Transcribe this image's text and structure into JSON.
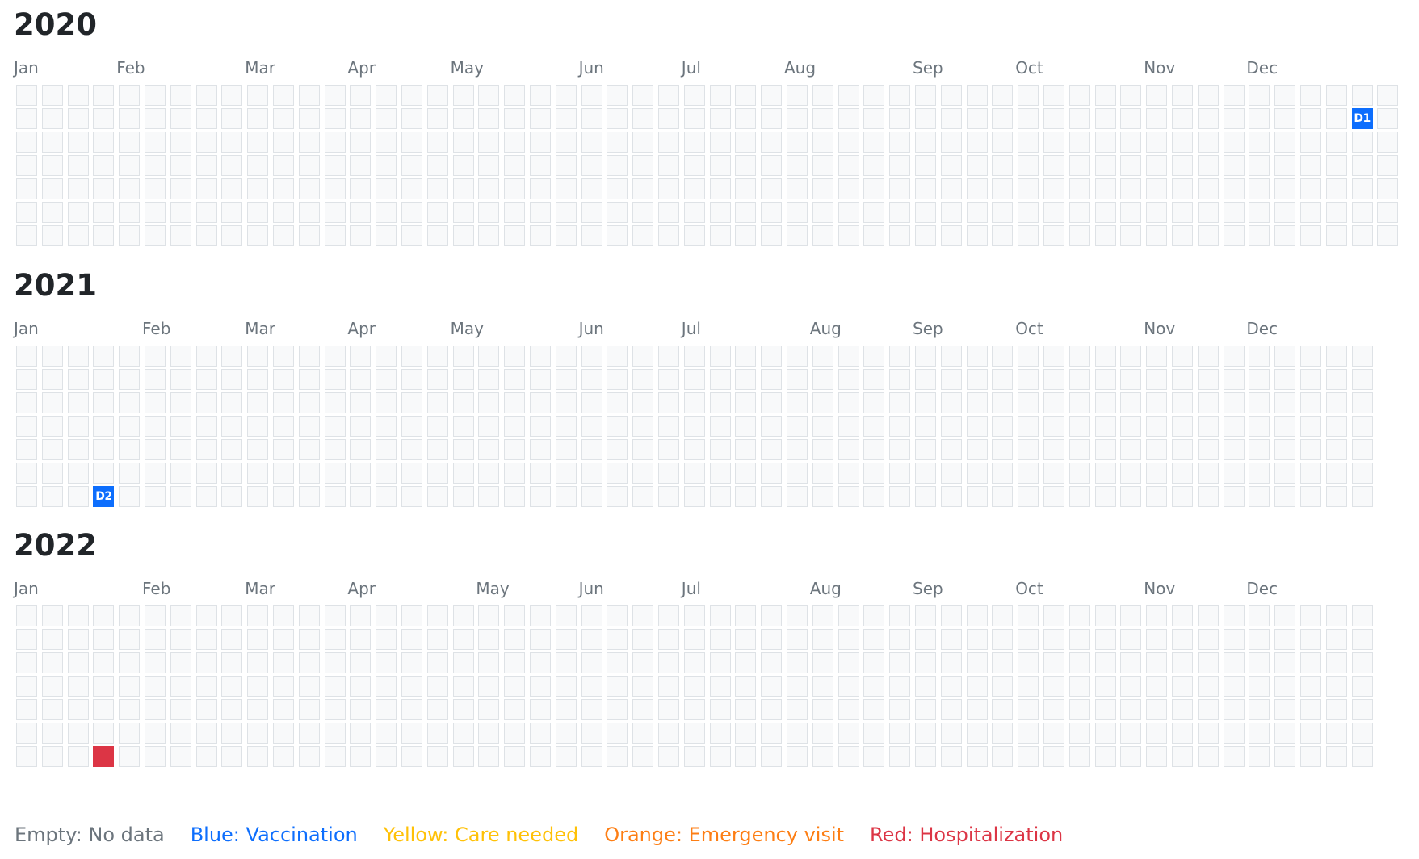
{
  "years": [
    {
      "label": "2020",
      "weeks": 54,
      "jan1_weekday": 3,
      "months": [
        "Jan",
        "Feb",
        "Mar",
        "Apr",
        "May",
        "Jun",
        "Jul",
        "Aug",
        "Sep",
        "Oct",
        "Nov",
        "Dec"
      ],
      "events": [
        {
          "week": 52,
          "day": 1,
          "type": "blue",
          "label": "D1"
        }
      ]
    },
    {
      "label": "2021",
      "weeks": 53,
      "jan1_weekday": 5,
      "months": [
        "Jan",
        "Feb",
        "Mar",
        "Apr",
        "May",
        "Jun",
        "Jul",
        "Aug",
        "Sep",
        "Oct",
        "Nov",
        "Dec"
      ],
      "events": [
        {
          "week": 3,
          "day": 6,
          "type": "blue",
          "label": "D2"
        }
      ]
    },
    {
      "label": "2022",
      "weeks": 53,
      "jan1_weekday": 6,
      "months": [
        "Jan",
        "Feb",
        "Mar",
        "Apr",
        "May",
        "Jun",
        "Jul",
        "Aug",
        "Sep",
        "Oct",
        "Nov",
        "Dec"
      ],
      "events": [
        {
          "week": 3,
          "day": 6,
          "type": "red",
          "label": ""
        }
      ]
    }
  ],
  "legend": [
    {
      "key": "empty",
      "text": "Empty: No data",
      "color": "#6c757d"
    },
    {
      "key": "blue",
      "text": "Blue: Vaccination",
      "color": "#0d6efd"
    },
    {
      "key": "yellow",
      "text": "Yellow: Care needed",
      "color": "#ffc107"
    },
    {
      "key": "orange",
      "text": "Orange: Emergency visit",
      "color": "#fd7e14"
    },
    {
      "key": "red",
      "text": "Red: Hospitalization",
      "color": "#dc3545"
    }
  ]
}
